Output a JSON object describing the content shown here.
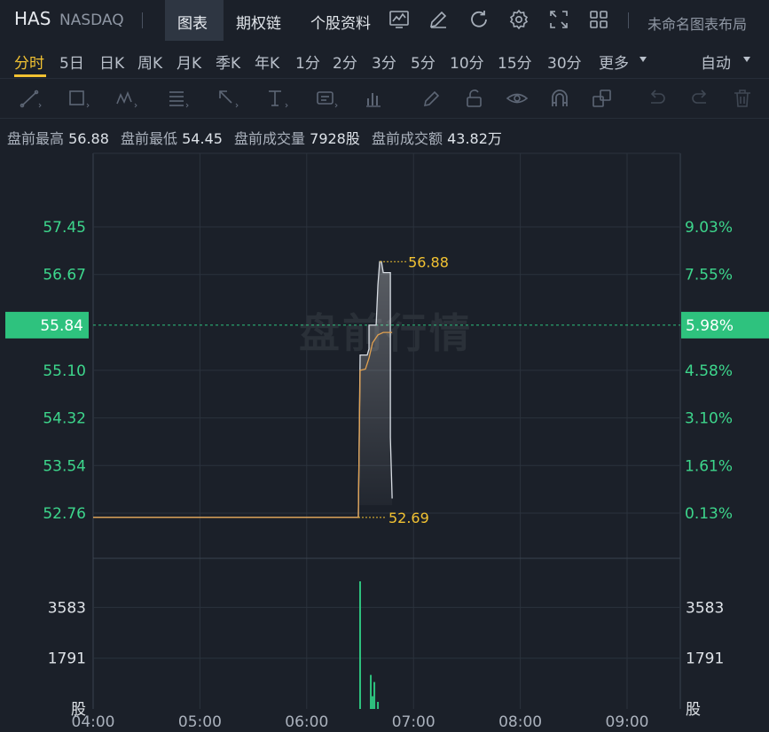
{
  "header": {
    "ticker": "HAS",
    "exchange": "NASDAQ",
    "tabs": [
      "图表",
      "期权链",
      "个股资料"
    ],
    "layout_name": "未命名图表布局",
    "icons": [
      "chart-style-icon",
      "draw-icon",
      "refresh-icon",
      "settings-icon",
      "fullscreen-icon",
      "layout-grid-icon"
    ]
  },
  "periods": {
    "items": [
      "分时",
      "5日",
      "日K",
      "周K",
      "月K",
      "季K",
      "年K",
      "1分",
      "2分",
      "3分",
      "5分",
      "10分",
      "15分",
      "30分",
      "更多"
    ],
    "active": "分时",
    "mode": "自动"
  },
  "toolbar_icons": [
    "trend-line-icon",
    "rectangle-icon",
    "pattern-icon",
    "fibonacci-icon",
    "arrow-icon",
    "text-icon",
    "annotation-icon",
    "measure-icon",
    "pencil-icon",
    "lock-icon",
    "eye-icon",
    "magnet-icon",
    "layers-icon",
    "undo-icon",
    "redo-icon",
    "delete-icon"
  ],
  "stats": {
    "high_label": "盘前最高",
    "high_value": "56.88",
    "low_label": "盘前最低",
    "low_value": "54.45",
    "volume_label": "盘前成交量",
    "volume_value": "7928股",
    "amount_label": "盘前成交额",
    "amount_value": "43.82万"
  },
  "watermark": "盘前行情",
  "colors": {
    "background": "#1b2029",
    "accent": "#f2c232",
    "up_green": "#2ec27e",
    "price_line": "#d8dde4",
    "avg_line": "#e0a050",
    "grid": "#2b323d"
  },
  "chart_data": {
    "type": "line",
    "x_ticks": [
      "04:00",
      "05:00",
      "06:00",
      "07:00",
      "08:00",
      "09:00"
    ],
    "price_ticks": [
      "57.45",
      "56.67",
      "55.10",
      "54.32",
      "53.54",
      "52.76"
    ],
    "percent_ticks": [
      "9.03%",
      "7.55%",
      "4.58%",
      "3.10%",
      "1.61%",
      "0.13%"
    ],
    "current_price": "55.84",
    "current_percent": "5.98%",
    "high_marker": "56.88",
    "low_marker": "52.69",
    "y_range": [
      52.3,
      57.8
    ],
    "volume_ticks": [
      "3583",
      "1791"
    ],
    "volume_unit": "股",
    "volume_range": [
      0,
      5000
    ],
    "series": [
      {
        "name": "price",
        "x": [
          "04:00",
          "06:29",
          "06:30",
          "06:34",
          "06:35",
          "06:35",
          "06:39",
          "06:40",
          "06:41",
          "06:42",
          "06:43",
          "06:44",
          "06:47",
          "06:47",
          "06:48"
        ],
        "y": [
          52.69,
          52.69,
          55.35,
          55.35,
          55.45,
          55.84,
          55.84,
          56.5,
          56.88,
          56.88,
          56.7,
          56.7,
          56.7,
          54.0,
          53.0
        ]
      },
      {
        "name": "average",
        "x": [
          "04:00",
          "06:29",
          "06:30",
          "06:33",
          "06:35",
          "06:37",
          "06:40",
          "06:43",
          "06:48"
        ],
        "y": [
          52.69,
          52.69,
          55.1,
          55.12,
          55.3,
          55.55,
          55.68,
          55.72,
          55.72
        ]
      }
    ],
    "volume": {
      "x": [
        "06:30",
        "06:36",
        "06:37",
        "06:38",
        "06:40"
      ],
      "v": [
        4500,
        1200,
        450,
        950,
        250
      ]
    }
  }
}
